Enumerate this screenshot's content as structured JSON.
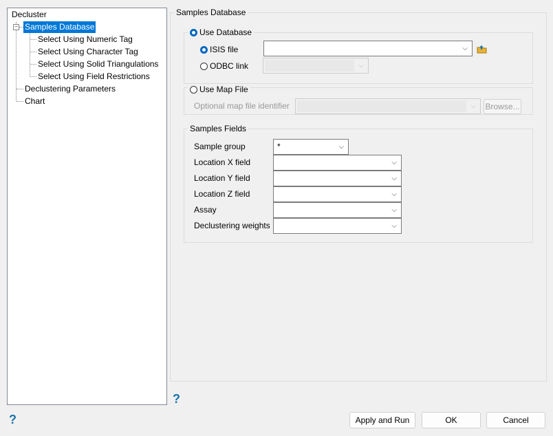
{
  "tree": {
    "root": "Decluster",
    "items": [
      {
        "label": "Samples Database",
        "selected": true
      },
      {
        "label": "Select Using Numeric Tag"
      },
      {
        "label": "Select Using Character Tag"
      },
      {
        "label": "Select Using Solid Triangulations"
      },
      {
        "label": "Select Using Field Restrictions"
      },
      {
        "label": "Declustering Parameters"
      },
      {
        "label": "Chart"
      }
    ]
  },
  "panel": {
    "title": "Samples Database",
    "use_database": {
      "label": "Use Database",
      "selected": true,
      "isis_label": "ISIS file",
      "isis_value": "",
      "odbc_label": "ODBC link"
    },
    "use_map": {
      "label": "Use Map File",
      "selected": false,
      "identifier_label": "Optional map file identifier",
      "browse": "Browse..."
    },
    "fields": {
      "title": "Samples Fields",
      "rows": [
        {
          "label": "Sample group",
          "value": "*"
        },
        {
          "label": "Location X field",
          "value": ""
        },
        {
          "label": "Location Y field",
          "value": ""
        },
        {
          "label": "Location Z field",
          "value": ""
        },
        {
          "label": "Assay",
          "value": ""
        },
        {
          "label": "Declustering weights",
          "value": ""
        }
      ]
    }
  },
  "buttons": {
    "apply": "Apply and Run",
    "ok": "OK",
    "cancel": "Cancel"
  },
  "help": "?",
  "chev": "⌵"
}
